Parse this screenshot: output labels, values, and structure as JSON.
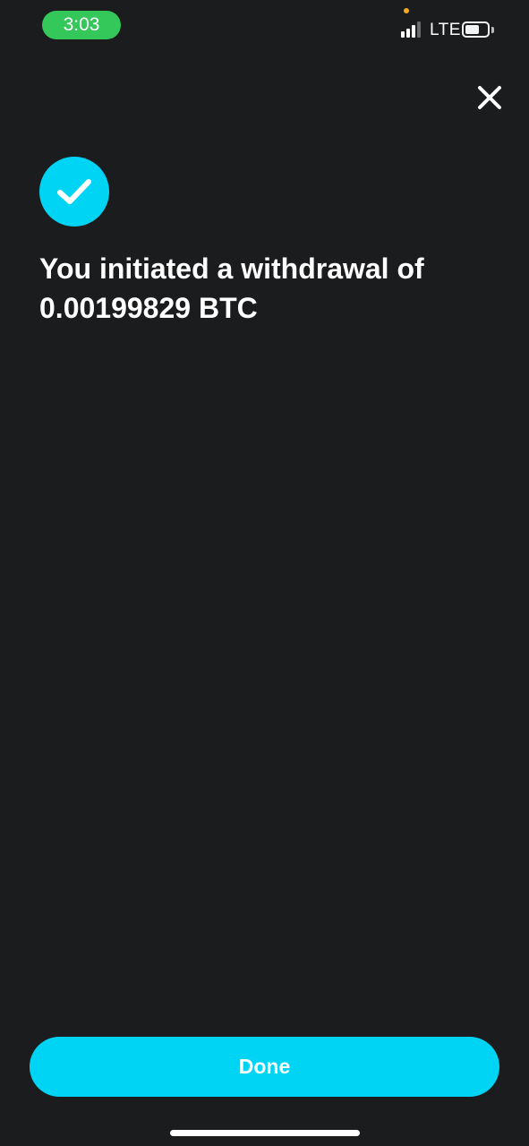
{
  "status_bar": {
    "time": "3:03",
    "network": "LTE",
    "signal_bars_filled": 3,
    "signal_bars_total": 4,
    "battery_level": 0.65,
    "icons": [
      "signal-icon",
      "battery-icon",
      "privacy-indicator-dot"
    ]
  },
  "header": {
    "close_icon": "close-icon"
  },
  "confirmation": {
    "icon": "checkmark-circle-icon",
    "line1": "You initiated a withdrawal of",
    "line2": "0.00199829 BTC"
  },
  "footer": {
    "done_label": "Done"
  },
  "colors": {
    "background": "#1b1c1e",
    "accent": "#00d4f5",
    "time_pill": "#34c759",
    "privacy_dot": "#f5a623",
    "text": "#ffffff"
  }
}
